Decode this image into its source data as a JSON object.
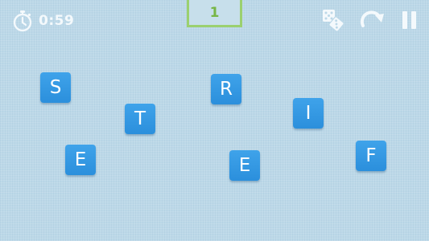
{
  "hud": {
    "timer": "0:59",
    "score": "1",
    "icons": {
      "timer": "stopwatch-icon",
      "shuffle": "dice-icon",
      "redo": "redo-arrow-icon",
      "pause": "pause-icon"
    }
  },
  "colors": {
    "background": "#bcd8e8",
    "tile": "#2b8fdc",
    "score_border": "#9bd06f",
    "score_text": "#77b646",
    "hud_icons": "#f4f9fc"
  },
  "tiles": [
    {
      "letter": "S"
    },
    {
      "letter": "T"
    },
    {
      "letter": "E"
    },
    {
      "letter": "R"
    },
    {
      "letter": "I"
    },
    {
      "letter": "E"
    },
    {
      "letter": "F"
    }
  ]
}
